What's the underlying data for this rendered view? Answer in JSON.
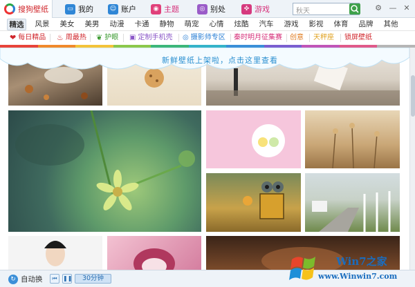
{
  "topbar": {
    "tabs": [
      {
        "label": "搜狗壁纸",
        "icon": "sogou-logo-icon"
      },
      {
        "label": "我的",
        "icon": "monitor-icon"
      },
      {
        "label": "账户",
        "icon": "user-icon"
      },
      {
        "label": "主题",
        "icon": "theme-icon"
      },
      {
        "label": "别处",
        "icon": "camera-icon"
      },
      {
        "label": "游戏",
        "icon": "gamepad-icon"
      }
    ],
    "search": {
      "placeholder": "秋天"
    },
    "window_buttons": [
      "⚙",
      "—",
      "✕"
    ]
  },
  "categories": {
    "items": [
      "精选",
      "风景",
      "美女",
      "美男",
      "动漫",
      "卡通",
      "静物",
      "萌宠",
      "心情",
      "炫酷",
      "汽车",
      "游戏",
      "影视",
      "体育",
      "品牌",
      "其他"
    ],
    "active": "精选"
  },
  "subcategories": [
    {
      "label": "每日精品",
      "icon": "heart-icon",
      "color": "#d0262b"
    },
    {
      "label": "周最热",
      "icon": "fire-icon",
      "color": "#d0262b"
    },
    {
      "label": "护眼",
      "icon": "leaf-icon",
      "color": "#3a9a2f"
    },
    {
      "label": "定制手机壳",
      "icon": "phone-case-icon",
      "color": "#8a56c7"
    },
    {
      "label": "摄影师专区",
      "icon": "camera-icon",
      "color": "#2a7fd5"
    },
    {
      "label": "秦时明月征集赛",
      "icon": "",
      "color": "#d6307a"
    },
    {
      "label": "创意",
      "icon": "",
      "color": "#e07b1f"
    },
    {
      "label": "天秤座",
      "icon": "",
      "color": "#e0a11f"
    },
    {
      "label": "锁屏壁纸",
      "icon": "",
      "color": "#d0262b"
    }
  ],
  "colorbar": [
    "#e8443a",
    "#f08a2c",
    "#f3c33a",
    "#8cc84b",
    "#3cb77a",
    "#35b3c9",
    "#3a8fd8",
    "#7a5fd0",
    "#c055b8",
    "#e05a8a",
    "#b6b6b6"
  ],
  "banner": {
    "text": "新鲜壁纸上架啦，点击这里查看"
  },
  "bottombar": {
    "auto_change_label": "自动换",
    "interval": "30分钟"
  },
  "watermark": {
    "line1": "Win7之家",
    "line2": "www.Winwin7.com"
  }
}
